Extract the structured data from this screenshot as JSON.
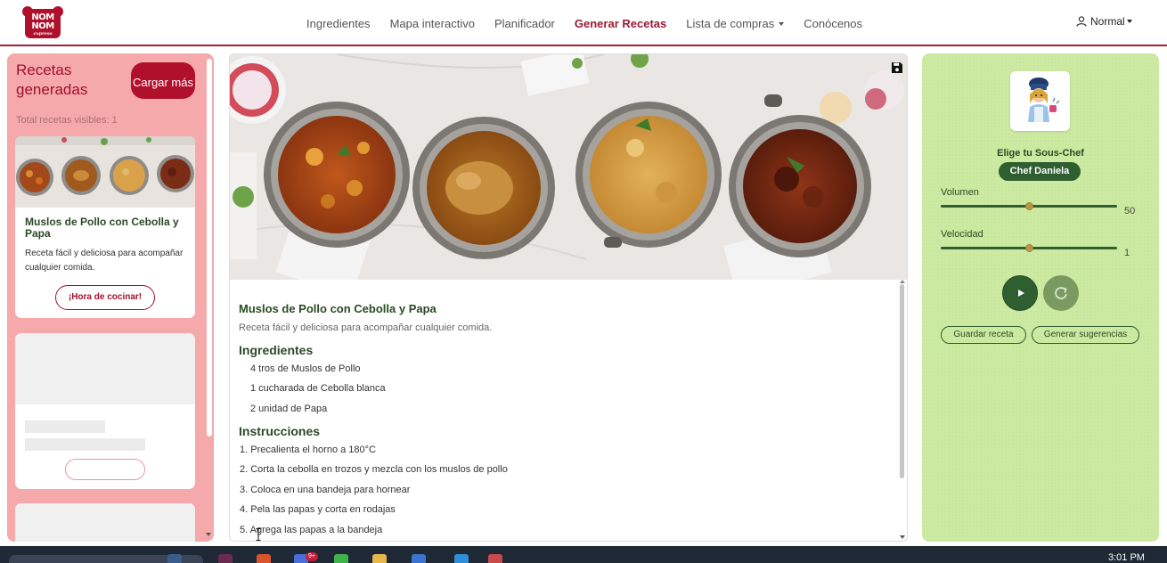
{
  "navbar": {
    "logo": {
      "line1": "NOM",
      "line2": "NOM",
      "line3": "express"
    },
    "links": [
      {
        "label": "Ingredientes"
      },
      {
        "label": "Mapa interactivo"
      },
      {
        "label": "Planificador"
      },
      {
        "label": "Generar Recetas",
        "active": true
      },
      {
        "label": "Lista de compras",
        "dropdown": true
      },
      {
        "label": "Conócenos"
      }
    ],
    "user_menu": {
      "label": "Normal",
      "icon": "user-icon"
    }
  },
  "left_panel": {
    "title": "Recetas generadas",
    "load_more_label": "Cargar más",
    "visible_count_text": "Total recetas visibles: 1",
    "recipe_card": {
      "title": "Muslos de Pollo con Cebolla y Papa",
      "description": "Receta fácil y deliciosa para acompañar cualquier comida.",
      "button_label": "¡Hora de cocinar!"
    }
  },
  "center_panel": {
    "save_icon": "floppy-disk-icon",
    "recipe": {
      "title": "Muslos de Pollo con Cebolla y Papa",
      "description": "Receta fácil y deliciosa para acompañar cualquier comida.",
      "ingredients_heading": "Ingredientes",
      "ingredients": [
        "4 tros de Muslos de Pollo",
        "1 cucharada de Cebolla blanca",
        "2 unidad de Papa"
      ],
      "instructions_heading": "Instrucciones",
      "instructions": [
        "1. Precalienta el horno a 180°C",
        "2. Corta la cebolla en trozos y mezcla con los muslos de pollo",
        "3. Coloca en una bandeja para hornear",
        "4. Pela las papas y corta en rodajas",
        "5. Agrega las papas a la bandeja"
      ]
    }
  },
  "right_panel": {
    "choose_label": "Elige tu Sous-Chef",
    "chef_name": "Chef Daniela",
    "volume_label": "Volumen",
    "volume_value": "50",
    "speed_label": "Velocidad",
    "speed_value": "1",
    "volume_level_fraction": 0.5,
    "speed_level_fraction": 0.5,
    "save_recipe_label": "Guardar receta",
    "suggestions_label": "Generar sugerencias"
  },
  "taskbar": {
    "time": "3:01 PM",
    "badge": "9+"
  },
  "colors": {
    "brand_red": "#b0102c",
    "active_link": "#9c1a33",
    "left_panel_bg": "#f5a9aa",
    "right_panel_bg": "#cdeaa2",
    "dark_green": "#2f5e31"
  }
}
